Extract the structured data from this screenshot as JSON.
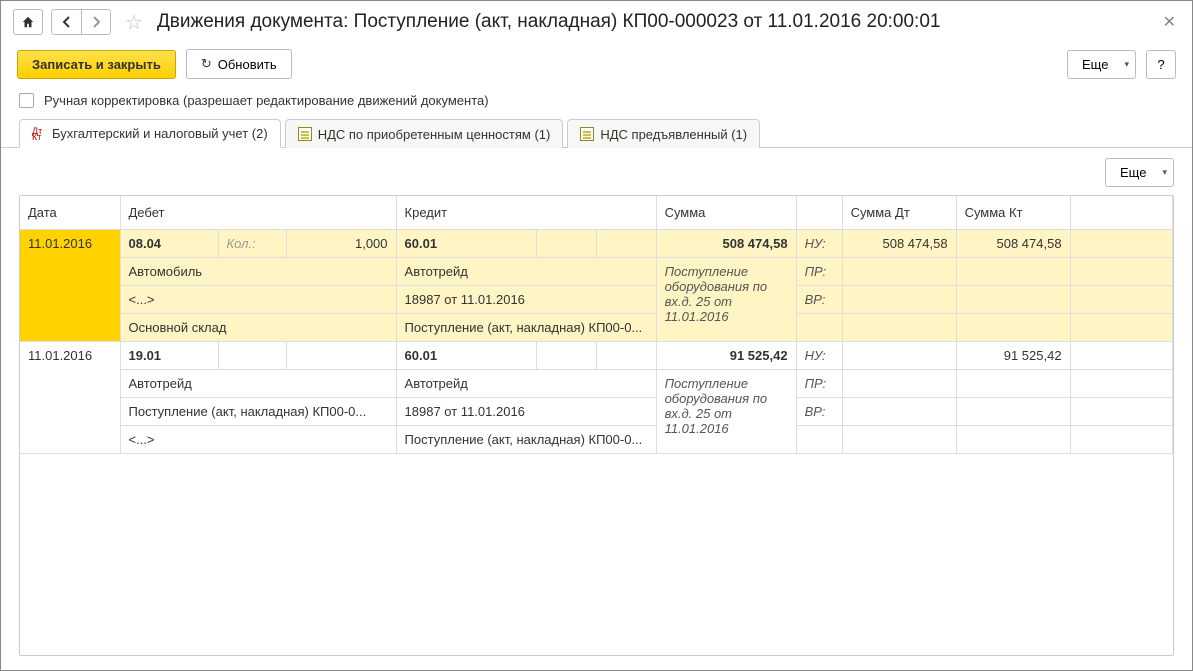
{
  "title": "Движения документа: Поступление (акт, накладная) КП00-000023 от 11.01.2016 20:00:01",
  "toolbar": {
    "save_close": "Записать и закрыть",
    "refresh": "Обновить",
    "more": "Еще",
    "help": "?"
  },
  "manual_edit": {
    "label": "Ручная корректировка (разрешает редактирование движений документа)",
    "checked": false
  },
  "tabs": [
    {
      "label": "Бухгалтерский и налоговый учет (2)",
      "active": true,
      "icon": "dtkt"
    },
    {
      "label": "НДС по приобретенным ценностям (1)",
      "active": false,
      "icon": "doc"
    },
    {
      "label": "НДС предъявленный (1)",
      "active": false,
      "icon": "doc"
    }
  ],
  "grid": {
    "more": "Еще",
    "headers": {
      "date": "Дата",
      "debit": "Дебет",
      "credit": "Кредит",
      "sum": "Сумма",
      "sum_dt": "Сумма Дт",
      "sum_kt": "Сумма Кт"
    },
    "qty_label": "Кол.:",
    "tags": {
      "nu": "НУ:",
      "pr": "ПР:",
      "vr": "ВР:"
    },
    "rows": [
      {
        "highlight": true,
        "date": "11.01.2016",
        "debit_acc": "08.04",
        "debit_qty": "1,000",
        "debit_lines": [
          "Автомобиль",
          "<...>",
          "Основной склад"
        ],
        "credit_acc": "60.01",
        "credit_lines": [
          "Автотрейд",
          "18987 от 11.01.2016",
          "Поступление (акт, накладная) КП00-0..."
        ],
        "sum": "508 474,58",
        "desc": "Поступление оборудования по вх.д. 25 от 11.01.2016",
        "sum_dt": "508 474,58",
        "sum_kt": "508 474,58"
      },
      {
        "highlight": false,
        "date": "11.01.2016",
        "debit_acc": "19.01",
        "debit_qty": "",
        "debit_lines": [
          "Автотрейд",
          "Поступление (акт, накладная) КП00-0...",
          "<...>"
        ],
        "credit_acc": "60.01",
        "credit_lines": [
          "Автотрейд",
          "18987 от 11.01.2016",
          "Поступление (акт, накладная) КП00-0..."
        ],
        "sum": "91 525,42",
        "desc": "Поступление оборудования по вх.д. 25 от 11.01.2016",
        "sum_dt": "",
        "sum_kt": "91 525,42"
      }
    ]
  }
}
